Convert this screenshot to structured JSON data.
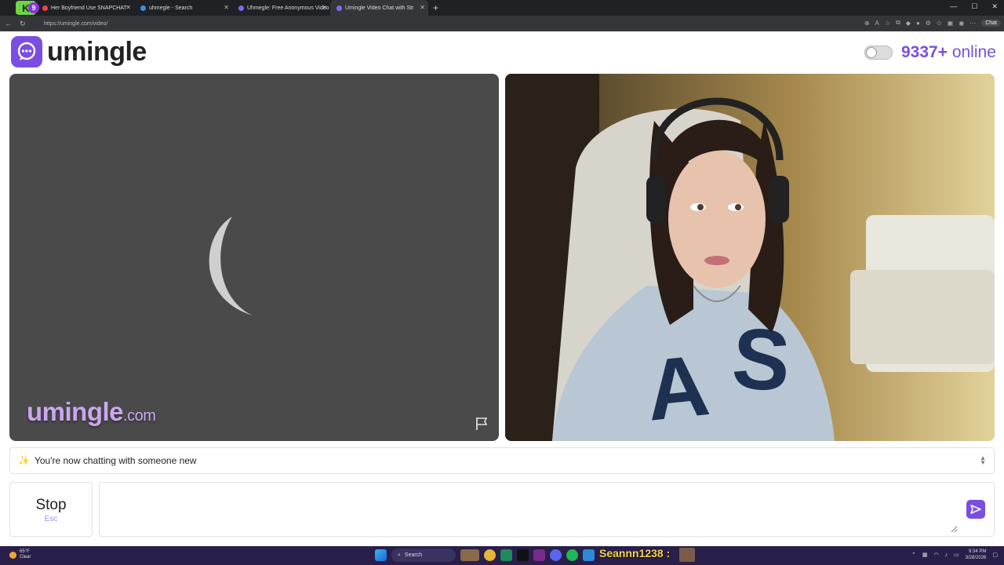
{
  "browser": {
    "tabs": [
      {
        "title": "Her Boyfriend Use SNAPCHAT",
        "active": false
      },
      {
        "title": "uhmegle - Search",
        "active": false
      },
      {
        "title": "Uhmegle: Free Anonymous Video",
        "active": false
      },
      {
        "title": "Umingle Video Chat with Str",
        "active": true
      }
    ],
    "extension_badge": "K",
    "extension_count": "9",
    "url": "https://umingle.com/video/",
    "chat_button": "Chat"
  },
  "header": {
    "logo_text": "umingle",
    "online_count": "9337+",
    "online_label": "online"
  },
  "video": {
    "watermark_main": "umingle",
    "watermark_suffix": ".com"
  },
  "chat": {
    "status_message": "You're now chatting with someone new",
    "stop_label": "Stop",
    "stop_key": "Esc",
    "input_placeholder": ""
  },
  "taskbar": {
    "weather_temp": "65°F",
    "weather_desc": "Clear",
    "search_label": "Search",
    "overlay_name": "Seannn1238 :",
    "time": "9:34 PM",
    "date": "3/28/2026"
  },
  "colors": {
    "brand": "#7a4fe0",
    "video_bg": "#4a4a4a"
  }
}
